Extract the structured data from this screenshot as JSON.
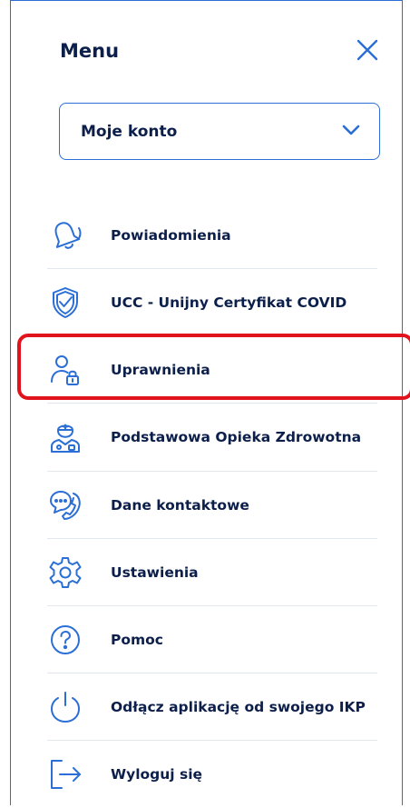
{
  "header": {
    "title": "Menu",
    "close_icon": "close-icon"
  },
  "account_select": {
    "value": "Moje konto",
    "icon": "chevron-down-icon"
  },
  "menu": {
    "items": [
      {
        "label": "Powiadomienia",
        "icon": "bell-icon"
      },
      {
        "label": "UCC - Unijny Certyfikat COVID",
        "icon": "shield-check-icon"
      },
      {
        "label": "Uprawnienia",
        "icon": "user-lock-icon"
      },
      {
        "label": "Podstawowa Opieka Zdrowotna",
        "icon": "doctor-icon"
      },
      {
        "label": "Dane kontaktowe",
        "icon": "phone-chat-icon"
      },
      {
        "label": "Ustawienia",
        "icon": "gear-icon"
      },
      {
        "label": "Pomoc",
        "icon": "question-icon"
      },
      {
        "label": "Odłącz aplikację od swojego IKP",
        "icon": "power-icon"
      },
      {
        "label": "Wyloguj się",
        "icon": "logout-icon"
      }
    ]
  },
  "colors": {
    "accent": "#2b6fd6",
    "text": "#0c1f4a",
    "highlight": "#e1141e"
  }
}
